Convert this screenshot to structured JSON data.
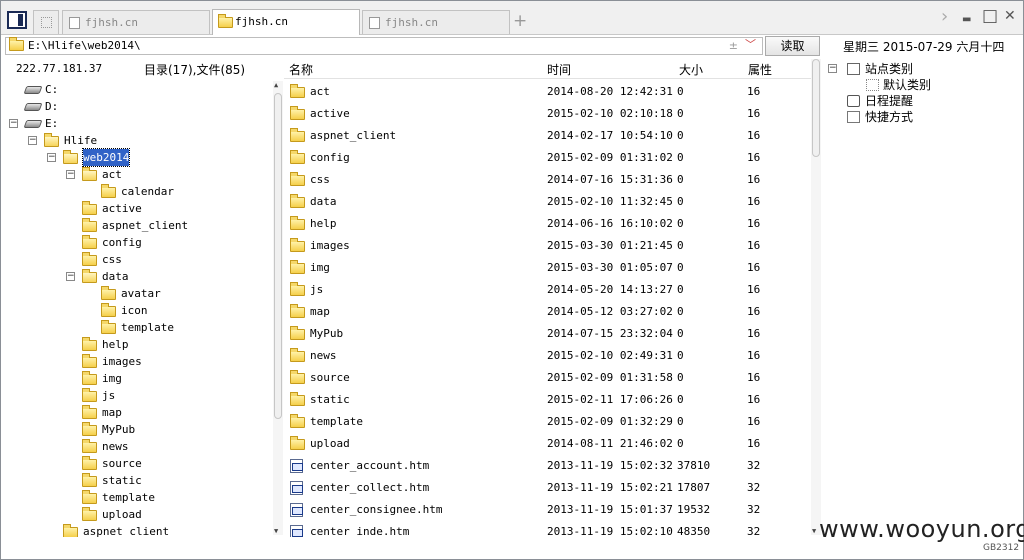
{
  "tabs": [
    {
      "label": "fjhsh.cn",
      "active": false
    },
    {
      "label": "fjhsh.cn",
      "active": true
    },
    {
      "label": "fjhsh.cn",
      "active": false
    }
  ],
  "new_tab": "+",
  "window_controls": {
    "next": "›",
    "minimize": "▬",
    "maximize": "□",
    "close": "✕"
  },
  "address": {
    "value": "E:\\Hlife\\web2014\\",
    "star": "±",
    "dropdown": "﹀"
  },
  "read_button": "读取",
  "date": "星期三 2015-07-29 六月十四",
  "ip": "222.77.181.37",
  "dir_summary": "目录(17),文件(85)",
  "tree": [
    {
      "label": "C:",
      "type": "drive",
      "depth": 1
    },
    {
      "label": "D:",
      "type": "drive",
      "depth": 1
    },
    {
      "label": "E:",
      "type": "drive",
      "depth": 1,
      "expanded": true
    },
    {
      "label": "Hlife",
      "type": "folder",
      "depth": 2,
      "expanded": true
    },
    {
      "label": "web2014",
      "type": "folder",
      "depth": 3,
      "expanded": true,
      "selected": true
    },
    {
      "label": "act",
      "type": "folder",
      "depth": 4,
      "expanded": true
    },
    {
      "label": "calendar",
      "type": "folder",
      "depth": 5
    },
    {
      "label": "active",
      "type": "folder",
      "depth": 4
    },
    {
      "label": "aspnet_client",
      "type": "folder",
      "depth": 4
    },
    {
      "label": "config",
      "type": "folder",
      "depth": 4
    },
    {
      "label": "css",
      "type": "folder",
      "depth": 4
    },
    {
      "label": "data",
      "type": "folder",
      "depth": 4,
      "expanded": true
    },
    {
      "label": "avatar",
      "type": "folder",
      "depth": 5
    },
    {
      "label": "icon",
      "type": "folder",
      "depth": 5
    },
    {
      "label": "template",
      "type": "folder",
      "depth": 5
    },
    {
      "label": "help",
      "type": "folder",
      "depth": 4
    },
    {
      "label": "images",
      "type": "folder",
      "depth": 4
    },
    {
      "label": "img",
      "type": "folder",
      "depth": 4
    },
    {
      "label": "js",
      "type": "folder",
      "depth": 4
    },
    {
      "label": "map",
      "type": "folder",
      "depth": 4
    },
    {
      "label": "MyPub",
      "type": "folder",
      "depth": 4
    },
    {
      "label": "news",
      "type": "folder",
      "depth": 4
    },
    {
      "label": "source",
      "type": "folder",
      "depth": 4
    },
    {
      "label": "static",
      "type": "folder",
      "depth": 4
    },
    {
      "label": "template",
      "type": "folder",
      "depth": 4
    },
    {
      "label": "upload",
      "type": "folder",
      "depth": 4
    },
    {
      "label": "aspnet_client",
      "type": "folder",
      "depth": 3
    }
  ],
  "columns": {
    "name": "名称",
    "time": "时间",
    "size": "大小",
    "attr": "属性"
  },
  "files": [
    {
      "name": "act",
      "time": "2014-08-20 12:42:31",
      "size": "0",
      "attr": "16",
      "type": "folder"
    },
    {
      "name": "active",
      "time": "2015-02-10 02:10:18",
      "size": "0",
      "attr": "16",
      "type": "folder"
    },
    {
      "name": "aspnet_client",
      "time": "2014-02-17 10:54:10",
      "size": "0",
      "attr": "16",
      "type": "folder"
    },
    {
      "name": "config",
      "time": "2015-02-09 01:31:02",
      "size": "0",
      "attr": "16",
      "type": "folder"
    },
    {
      "name": "css",
      "time": "2014-07-16 15:31:36",
      "size": "0",
      "attr": "16",
      "type": "folder"
    },
    {
      "name": "data",
      "time": "2015-02-10 11:32:45",
      "size": "0",
      "attr": "16",
      "type": "folder"
    },
    {
      "name": "help",
      "time": "2014-06-16 16:10:02",
      "size": "0",
      "attr": "16",
      "type": "folder"
    },
    {
      "name": "images",
      "time": "2015-03-30 01:21:45",
      "size": "0",
      "attr": "16",
      "type": "folder"
    },
    {
      "name": "img",
      "time": "2015-03-30 01:05:07",
      "size": "0",
      "attr": "16",
      "type": "folder"
    },
    {
      "name": "js",
      "time": "2014-05-20 14:13:27",
      "size": "0",
      "attr": "16",
      "type": "folder"
    },
    {
      "name": "map",
      "time": "2014-05-12 03:27:02",
      "size": "0",
      "attr": "16",
      "type": "folder"
    },
    {
      "name": "MyPub",
      "time": "2014-07-15 23:32:04",
      "size": "0",
      "attr": "16",
      "type": "folder"
    },
    {
      "name": "news",
      "time": "2015-02-10 02:49:31",
      "size": "0",
      "attr": "16",
      "type": "folder"
    },
    {
      "name": "source",
      "time": "2015-02-09 01:31:58",
      "size": "0",
      "attr": "16",
      "type": "folder"
    },
    {
      "name": "static",
      "time": "2015-02-11 17:06:26",
      "size": "0",
      "attr": "16",
      "type": "folder"
    },
    {
      "name": "template",
      "time": "2015-02-09 01:32:29",
      "size": "0",
      "attr": "16",
      "type": "folder"
    },
    {
      "name": "upload",
      "time": "2014-08-11 21:46:02",
      "size": "0",
      "attr": "16",
      "type": "folder"
    },
    {
      "name": "center_account.htm",
      "time": "2013-11-19 15:02:32",
      "size": "37810",
      "attr": "32",
      "type": "file"
    },
    {
      "name": "center_collect.htm",
      "time": "2013-11-19 15:02:21",
      "size": "17807",
      "attr": "32",
      "type": "file"
    },
    {
      "name": "center_consignee.htm",
      "time": "2013-11-19 15:01:37",
      "size": "19532",
      "attr": "32",
      "type": "file"
    },
    {
      "name": "center_inde.htm",
      "time": "2013-11-19 15:02:10",
      "size": "48350",
      "attr": "32",
      "type": "file"
    }
  ],
  "right_panel": {
    "site_category": "站点类别",
    "default_category": "默认类别",
    "reminder": "日程提醒",
    "shortcut": "快捷方式"
  },
  "watermark": "www.wooyun.org",
  "corner_tag": "GB2312"
}
